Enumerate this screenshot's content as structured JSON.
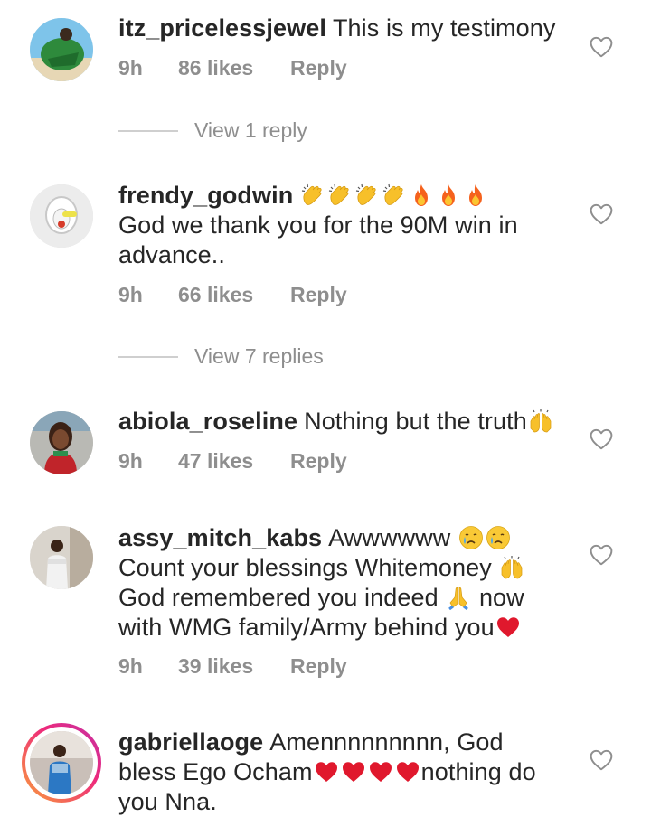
{
  "comments": [
    {
      "username": "itz_pricelessjewel",
      "text": "This is my testimony",
      "time": "9h",
      "likes": "86 likes",
      "reply": "Reply",
      "view_replies": "View 1 reply"
    },
    {
      "username": "frendy_godwin",
      "text_line1": "God we thank you for the 90M win in advance..",
      "time": "9h",
      "likes": "66 likes",
      "reply": "Reply",
      "view_replies": "View 7 replies"
    },
    {
      "username": "abiola_roseline",
      "text": "Nothing but the truth",
      "time": "9h",
      "likes": "47 likes",
      "reply": "Reply"
    },
    {
      "username": "assy_mitch_kabs",
      "text_a": "Awwwwww",
      "text_b": "Count your blessings Whitemoney",
      "text_c": "God remembered you indeed",
      "text_d": "now with WMG family/Army behind you",
      "time": "9h",
      "likes": "39 likes",
      "reply": "Reply"
    },
    {
      "username": "gabriellaoge",
      "text_a": "Amennnnnnnnn, God bless Ego Ocham",
      "text_b": "nothing do you Nna."
    }
  ],
  "icons": {
    "like": "heart-outline-icon",
    "clap": "clapping-hands-emoji",
    "fire": "fire-emoji",
    "raised_hands": "raising-hands-emoji",
    "crying": "crying-face-emoji",
    "pray": "folded-hands-emoji",
    "heart": "red-heart-emoji"
  },
  "colors": {
    "text": "#262626",
    "meta": "#8e8e8e",
    "story_ring_start": "#f9a13a",
    "story_ring_end": "#c231a7"
  }
}
